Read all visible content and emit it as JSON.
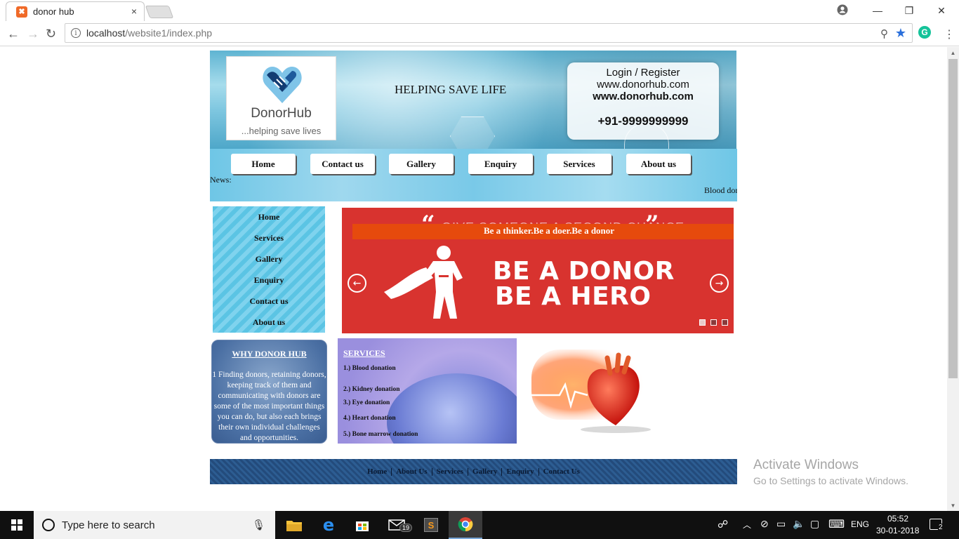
{
  "browser": {
    "tab_title": "donor hub",
    "tab_close": "×",
    "url_host": "localhost",
    "url_path": "/website1/index.php",
    "window_controls": {
      "minimize": "—",
      "maximize": "❐",
      "close": "✕"
    }
  },
  "header": {
    "logo_name": "DonorHub",
    "logo_tagline": "...helping save lives",
    "tagline": "HELPING SAVE LIFE",
    "login_register": "Login / Register",
    "website1": "www.donorhub.com",
    "website2": "www.donorhub.com",
    "phone": "+91-9999999999"
  },
  "nav": {
    "items": [
      "Home",
      "Contact us",
      "Gallery",
      "Enquiry",
      "Services",
      "About us"
    ],
    "news_label": "News:",
    "news_ticker": "Blood donation"
  },
  "sidebar": {
    "items": [
      "Home",
      "Services",
      "Gallery",
      "Enquiry",
      "Contact us",
      "About us"
    ]
  },
  "slider": {
    "background_text": "GIVE SOMEONE A SECOND CHANCE",
    "caption": "Be a thinker.Be a doer.Be a donor",
    "hero_line1": "BE A DONOR",
    "hero_line2": "BE A HERO",
    "prev": "←",
    "next": "→",
    "slide_count": 3,
    "active_slide": 1
  },
  "why": {
    "title": "WHY DONOR HUB",
    "text": "1 Finding donors, retaining donors, keeping track of them and communicating with donors are some of the most important things you can do, but also each brings their own individual challenges and opportunities."
  },
  "services": {
    "title": "SERVICES",
    "items": [
      "1.) Blood donation",
      "2.) Kidney donation",
      "3.) Eye donation",
      "4.) Heart donation",
      "5.) Bone marrow donation"
    ]
  },
  "footer": {
    "links": [
      "Home",
      "About Us",
      "Services",
      "Gallery",
      "Enquiry",
      "Contact Us"
    ]
  },
  "watermark": {
    "line1": "Activate Windows",
    "line2": "Go to Settings to activate Windows."
  },
  "taskbar": {
    "search_placeholder": "Type here to search",
    "mail_badge": "19",
    "language": "ENG",
    "time": "05:52",
    "date": "30-01-2018",
    "notification_count": "2"
  },
  "colors": {
    "slider_red": "#d8332f",
    "caption_orange": "#e64a0d",
    "nav_blue": "#7fc7e0",
    "footer_navy": "#234b7c"
  }
}
